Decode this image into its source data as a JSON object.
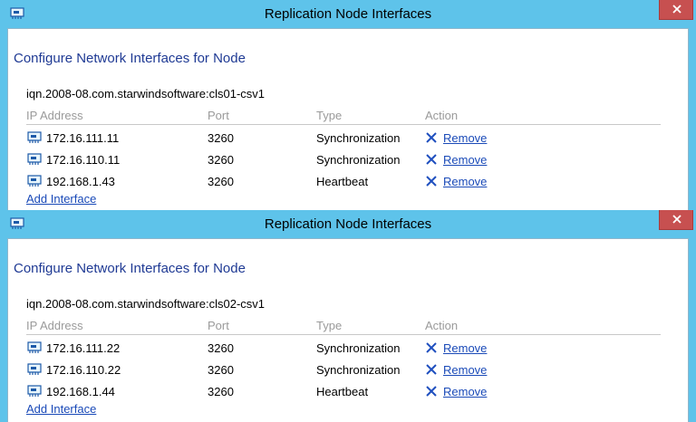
{
  "windows": [
    {
      "title": "Replication Node Interfaces",
      "heading": "Configure Network Interfaces for Node",
      "node": "iqn.2008-08.com.starwindsoftware:cls01-csv1",
      "columns": [
        "IP Address",
        "Port",
        "Type",
        "Action"
      ],
      "rows": [
        {
          "ip": "172.16.111.11",
          "port": "3260",
          "type": "Synchronization",
          "action": "Remove"
        },
        {
          "ip": "172.16.110.11",
          "port": "3260",
          "type": "Synchronization",
          "action": "Remove"
        },
        {
          "ip": "192.168.1.43",
          "port": "3260",
          "type": "Heartbeat",
          "action": "Remove"
        }
      ],
      "add_label": "Add Interface"
    },
    {
      "title": "Replication Node Interfaces",
      "heading": "Configure Network Interfaces for Node",
      "node": "iqn.2008-08.com.starwindsoftware:cls02-csv1",
      "columns": [
        "IP Address",
        "Port",
        "Type",
        "Action"
      ],
      "rows": [
        {
          "ip": "172.16.111.22",
          "port": "3260",
          "type": "Synchronization",
          "action": "Remove"
        },
        {
          "ip": "172.16.110.22",
          "port": "3260",
          "type": "Synchronization",
          "action": "Remove"
        },
        {
          "ip": "192.168.1.44",
          "port": "3260",
          "type": "Heartbeat",
          "action": "Remove"
        }
      ],
      "add_label": "Add Interface"
    }
  ],
  "icons": {
    "app": "network-card-icon",
    "row": "network-card-icon",
    "remove": "x-icon",
    "close": "close-icon"
  },
  "colors": {
    "titlebar": "#5ec3ea",
    "close_button": "#c75050",
    "heading": "#1f3a94",
    "link": "#1a4ab8",
    "remove_x": "#1f4fbf"
  }
}
